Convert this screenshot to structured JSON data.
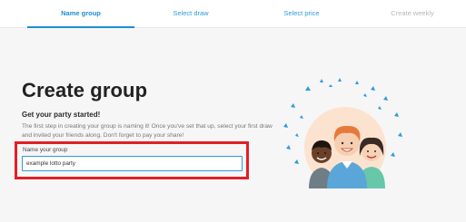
{
  "stepper": {
    "steps": [
      {
        "label": "Name group",
        "state": "active"
      },
      {
        "label": "Select draw",
        "state": "enabled"
      },
      {
        "label": "Select price",
        "state": "enabled"
      },
      {
        "label": "Create weekly",
        "state": "disabled"
      }
    ]
  },
  "main": {
    "title": "Create group",
    "subtitle": "Get your party started!",
    "description": "The first step in creating your group is naming it! Once you've set that up, select your first draw and invited your friends along. Don't forget to pay your share!",
    "name_field": {
      "label": "Name your group",
      "value": "example lotto party"
    }
  },
  "illustration": {
    "icon": "group-of-friends-illustration"
  },
  "colors": {
    "accent": "#2d9cdb",
    "highlight": "#e31e26",
    "background": "#f6f6f6"
  }
}
